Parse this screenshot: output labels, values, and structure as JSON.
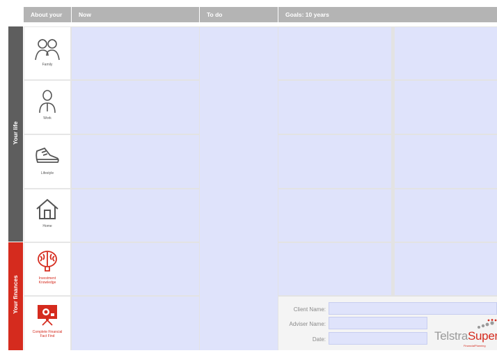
{
  "headers": {
    "about": "About your",
    "now": "Now",
    "todo": "To do",
    "goals": "Goals: 10 years"
  },
  "sections": {
    "life": "Your life",
    "finances": "Your finances"
  },
  "rows": [
    {
      "label": "Family",
      "icon": "family-icon"
    },
    {
      "label": "Work",
      "icon": "person-icon"
    },
    {
      "label": "Lifestyle",
      "icon": "shoe-icon"
    },
    {
      "label": "Home",
      "icon": "house-icon"
    },
    {
      "label": "Investment Knowledge",
      "icon": "brain-icon"
    },
    {
      "label": "Complete Financial Fact Find",
      "icon": "presentation-icon"
    }
  ],
  "form": {
    "client_label": "Client Name:",
    "adviser_label": "Adviser Name:",
    "date_label": "Date:",
    "client_value": "",
    "adviser_value": "",
    "date_value": ""
  },
  "brand": {
    "name_part1": "Telstra",
    "name_part2": "Super",
    "tagline": "FinancialPlanning"
  },
  "colors": {
    "header_grey": "#b4b4b4",
    "life_band": "#5e5e5e",
    "finance_band": "#d52b1e",
    "field_blue": "#dfe3fb"
  }
}
